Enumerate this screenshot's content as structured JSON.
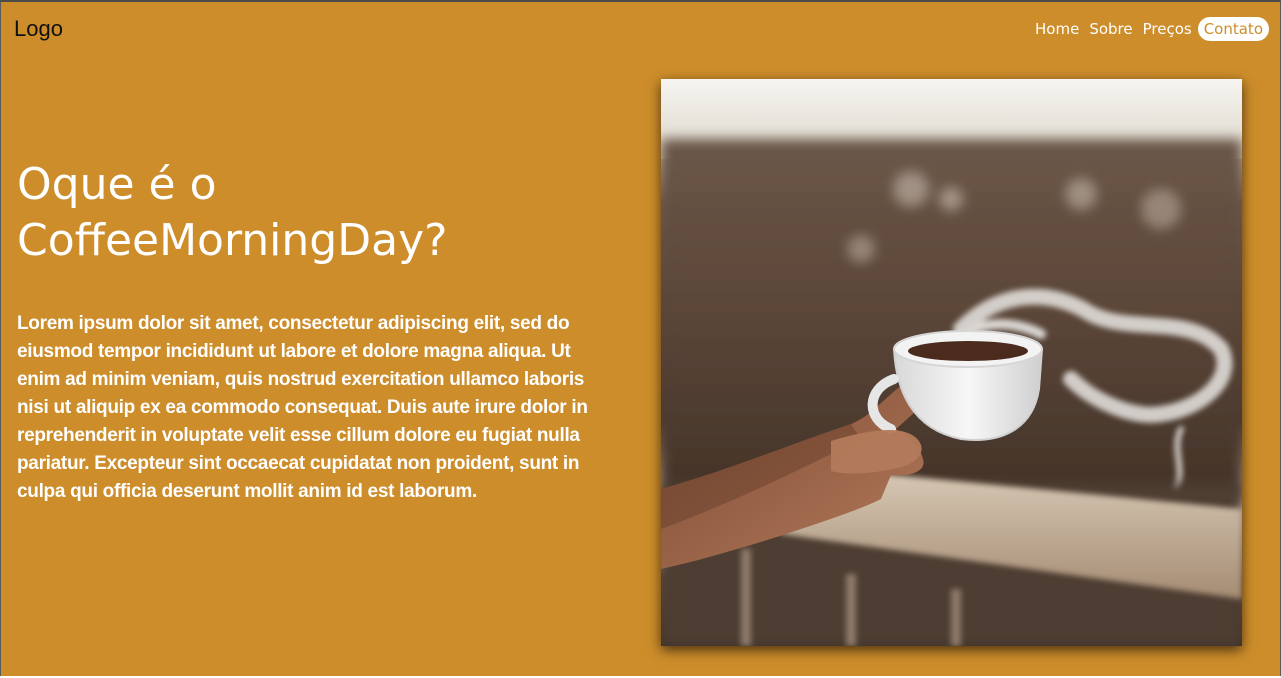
{
  "header": {
    "logo": "Logo",
    "nav": [
      {
        "label": "Home"
      },
      {
        "label": "Sobre"
      },
      {
        "label": "Preços"
      },
      {
        "label": "Contato",
        "active": true
      }
    ]
  },
  "hero": {
    "title": "Oque é o CoffeeMorningDay?",
    "text": "Lorem ipsum dolor sit amet, consectetur adipiscing elit, sed do eiusmod tempor incididunt ut labore et dolore magna aliqua. Ut enim ad minim veniam, quis nostrud exercitation ullamco laboris nisi ut aliquip ex ea commodo consequat. Duis aute irure dolor in reprehenderit in voluptate velit esse cillum dolore eu fugiat nulla pariatur. Excepteur sint occaecat cupidatat non proident, sunt in culpa qui officia deserunt mollit anim id est laborum."
  },
  "colors": {
    "background": "#cd8d2b",
    "text": "#ffffff",
    "logo": "#111111"
  },
  "icons": {
    "photo": "coffee-cup-hand-image"
  }
}
